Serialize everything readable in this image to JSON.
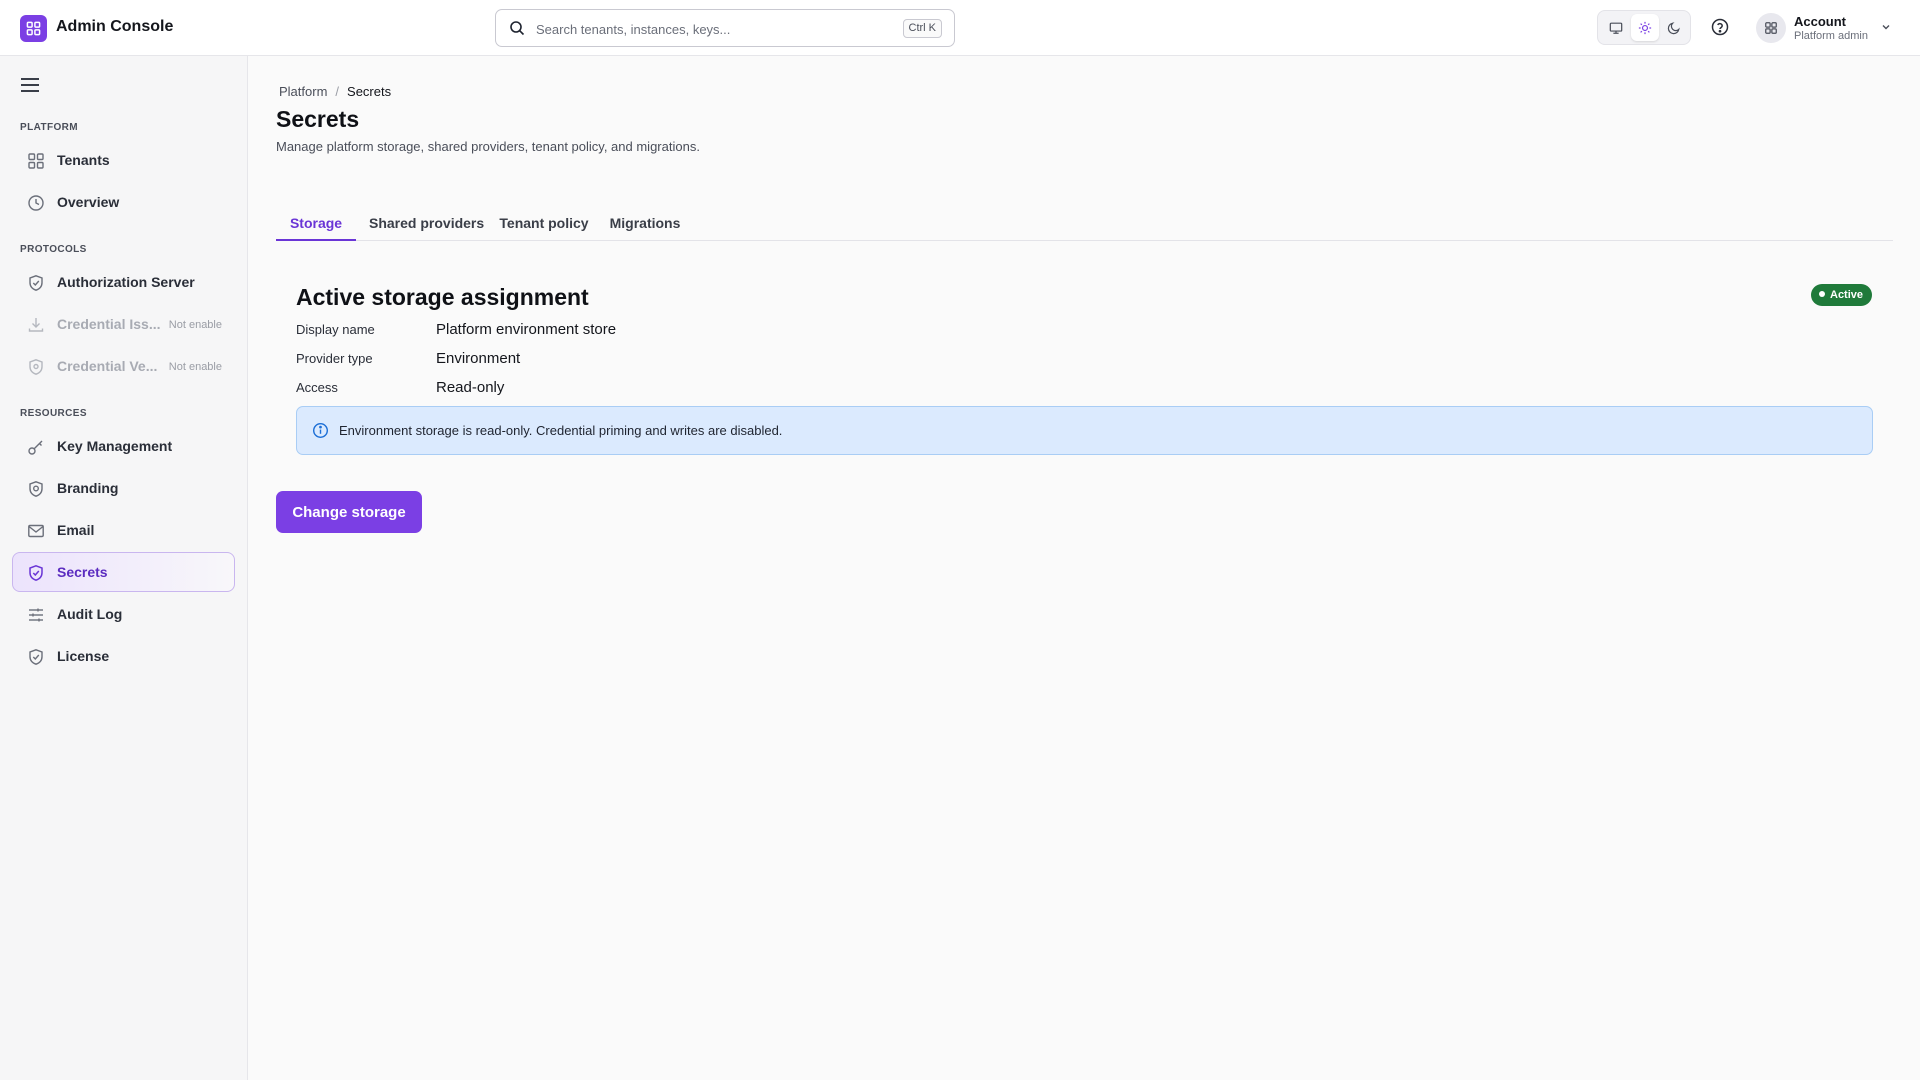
{
  "app": {
    "title": "Admin Console",
    "accent": "#7b3fe4"
  },
  "search": {
    "placeholder": "Search tenants, instances, keys...",
    "shortcut": "Ctrl K"
  },
  "account": {
    "name": "Account",
    "role": "Platform admin"
  },
  "sidebar": {
    "sections": [
      {
        "label": "PLATFORM"
      },
      {
        "label": "PROTOCOLS"
      },
      {
        "label": "RESOURCES"
      }
    ],
    "items": [
      {
        "label": "Tenants",
        "icon": "grid-icon"
      },
      {
        "label": "Overview",
        "icon": "clock-icon"
      },
      {
        "label": "Authorization Server",
        "icon": "shield-check-icon"
      },
      {
        "label": "Credential Iss...",
        "tag": "Not enable",
        "icon": "download-icon",
        "disabled": true
      },
      {
        "label": "Credential Ve...",
        "tag": "Not enable",
        "icon": "shield-icon",
        "disabled": true
      },
      {
        "label": "Key Management",
        "icon": "key-icon"
      },
      {
        "label": "Branding",
        "icon": "badge-icon"
      },
      {
        "label": "Email",
        "icon": "mail-icon"
      },
      {
        "label": "Secrets",
        "icon": "shield-check-icon",
        "selected": true
      },
      {
        "label": "Audit Log",
        "icon": "sliders-icon"
      },
      {
        "label": "License",
        "icon": "shield-check-icon"
      }
    ]
  },
  "breadcrumb": {
    "root": "Platform",
    "separator": "/",
    "current": "Secrets"
  },
  "page": {
    "title": "Secrets",
    "subtitle": "Manage platform storage, shared providers, tenant policy, and migrations."
  },
  "tabs": [
    {
      "label": "Storage",
      "active": true
    },
    {
      "label": "Shared providers"
    },
    {
      "label": "Tenant policy"
    },
    {
      "label": "Migrations"
    }
  ],
  "storage": {
    "title": "Active storage assignment",
    "status": "Active",
    "status_color": "#1f7a3a",
    "fields": [
      {
        "label": "Display name",
        "value": "Platform environment store"
      },
      {
        "label": "Provider type",
        "value": "Environment"
      },
      {
        "label": "Access",
        "value": "Read-only"
      }
    ],
    "notice": "Environment storage is read-only. Credential priming and writes are disabled.",
    "action_label": "Change storage"
  }
}
